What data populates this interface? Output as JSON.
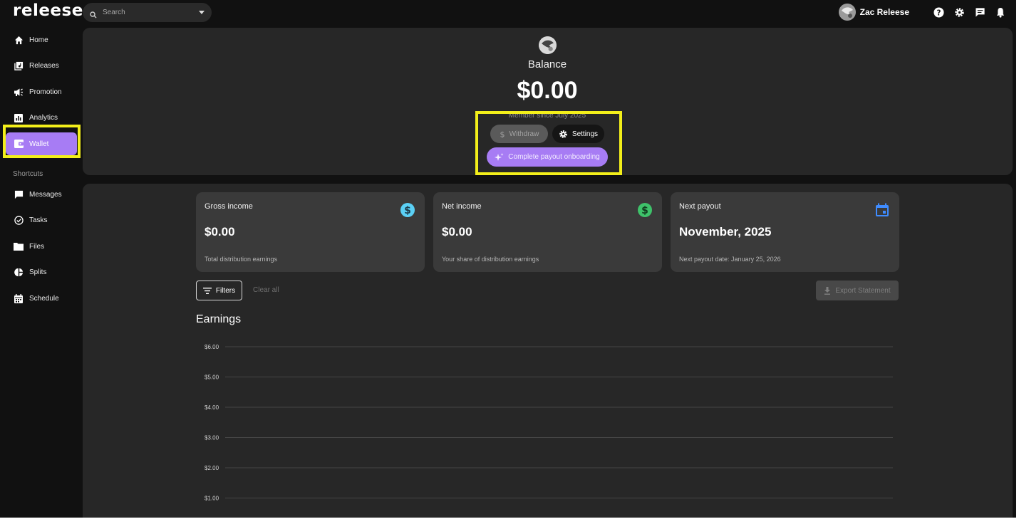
{
  "app": {
    "logo": "releese"
  },
  "search": {
    "placeholder": "Search"
  },
  "user": {
    "name": "Zac Releese"
  },
  "topbar_icons": [
    "help-icon",
    "settings-icon",
    "feedback-icon",
    "notifications-icon"
  ],
  "sidebar": {
    "items": [
      {
        "label": "Home",
        "icon": "home-icon"
      },
      {
        "label": "Releases",
        "icon": "releases-icon"
      },
      {
        "label": "Promotion",
        "icon": "megaphone-icon"
      },
      {
        "label": "Analytics",
        "icon": "analytics-icon"
      },
      {
        "label": "Wallet",
        "icon": "wallet-icon",
        "active": true
      }
    ],
    "shortcuts_title": "Shortcuts",
    "shortcuts": [
      {
        "label": "Messages",
        "icon": "message-icon"
      },
      {
        "label": "Tasks",
        "icon": "check-circle-icon"
      },
      {
        "label": "Files",
        "icon": "folder-icon"
      },
      {
        "label": "Splits",
        "icon": "pie-icon"
      },
      {
        "label": "Schedule",
        "icon": "calendar-icon"
      }
    ]
  },
  "balance": {
    "label": "Balance",
    "amount": "$0.00",
    "member_since": "Member since July 2025",
    "withdraw_label": "Withdraw",
    "settings_label": "Settings",
    "onboarding_label": "Complete payout onboarding"
  },
  "cards": [
    {
      "title": "Gross income",
      "value": "$0.00",
      "subtitle": "Total distribution earnings",
      "icon": "dollar-circle-icon",
      "color": "#5bd0f5"
    },
    {
      "title": "Net income",
      "value": "$0.00",
      "subtitle": "Your share of distribution earnings",
      "icon": "dollar-circle-icon",
      "color": "#3ec26a"
    },
    {
      "title": "Next payout",
      "value": "November, 2025",
      "subtitle": "Next payout date: January 25, 2026",
      "icon": "calendar-icon",
      "color": "#3f8cff"
    }
  ],
  "filters": {
    "filters_label": "Filters",
    "clear_label": "Clear all",
    "export_label": "Export Statement"
  },
  "earnings": {
    "title": "Earnings"
  },
  "colors": {
    "accent": "#a77cf4",
    "highlight": "#f3ef1a",
    "panel": "#272727",
    "background": "#111111"
  },
  "chart_data": {
    "type": "line",
    "title": "Earnings",
    "y_ticks": [
      "$6.00",
      "$5.00",
      "$4.00",
      "$3.00",
      "$2.00",
      "$1.00"
    ],
    "y_tick_values": [
      6,
      5,
      4,
      3,
      2,
      1
    ],
    "ylim": [
      0,
      6
    ],
    "series": [],
    "grid": true
  }
}
